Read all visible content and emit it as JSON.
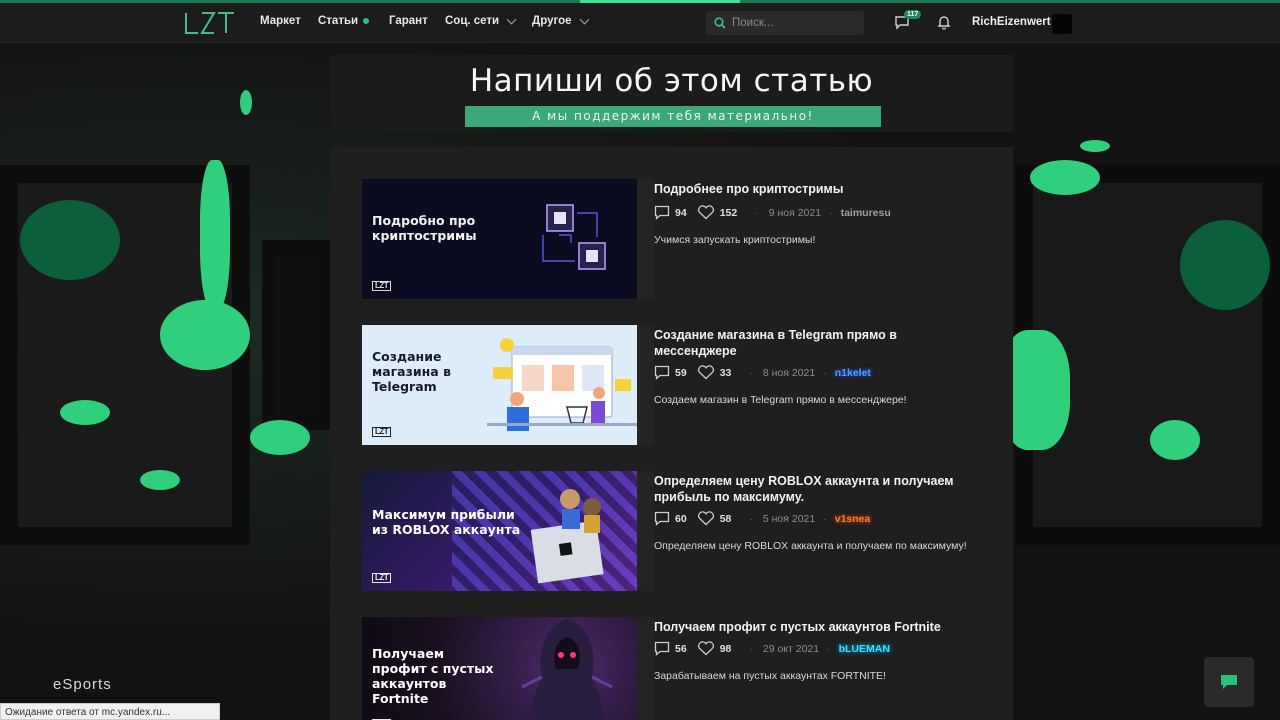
{
  "nav": {
    "items": [
      {
        "label": "Маркет"
      },
      {
        "label": "Статьи"
      },
      {
        "label": "Гарант"
      },
      {
        "label": "Соц. сети"
      },
      {
        "label": "Другое"
      }
    ],
    "search_placeholder": "Поиск...",
    "notifications_count": "117",
    "username": "RichEizenwert"
  },
  "banner": {
    "title": "Напиши об этом статью",
    "subtitle": "А мы поддержим тебя материально!"
  },
  "articles": [
    {
      "thumb_title": "Подробно про криптостримы",
      "title": "Подробнее про криптостримы",
      "comments": "94",
      "likes": "152",
      "date": "9 ноя 2021",
      "author": "taimuresu",
      "description": "Учимся запускать криптостримы!"
    },
    {
      "thumb_title": "Создание магазина в Telegram",
      "title": "Создание магазина в Telegram прямо в мессенджере",
      "comments": "59",
      "likes": "33",
      "date": "8 ноя 2021",
      "author": "n1kelet",
      "description": "Создаем магазин в Telegram прямо в мессенджере!"
    },
    {
      "thumb_title": "Максимум прибыли из ROBLOX аккаунта",
      "title": "Определяем цену ROBLOX аккаунта и получаем прибыль по максимуму.",
      "comments": "60",
      "likes": "58",
      "date": "5 ноя 2021",
      "author": "v1snea",
      "description": "Определяем цену ROBLOX аккаунта и получаем по максимуму!"
    },
    {
      "thumb_title": "Получаем профит с пустых аккаунтов Fortnite",
      "title": "Получаем профит с пустых аккаунтов Fortnite",
      "comments": "56",
      "likes": "98",
      "date": "29 окт 2021",
      "author": "bLUEMAN",
      "description": "Зарабатываем на пустых аккаунтах FORTNITE!"
    }
  ],
  "thumb_logo": "LZT",
  "footer": {
    "esports": "eSports",
    "status": "Ожидание ответа от mc.yandex.ru..."
  },
  "colors": {
    "accent": "#2fbf7a",
    "author_n1kelet": "#3a7bff",
    "author_v1snea": "#ff6a1a",
    "author_blueman": "#35d6ff"
  }
}
